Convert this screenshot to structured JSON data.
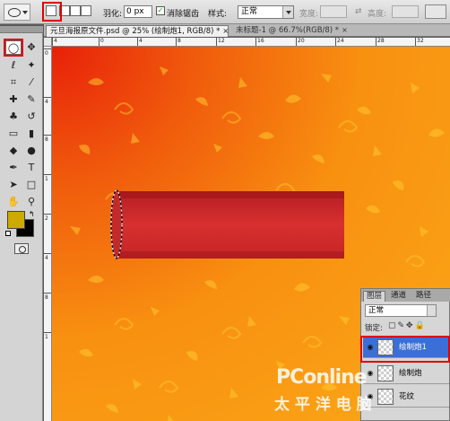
{
  "options_bar": {
    "feather_label": "羽化:",
    "feather_value": "0 px",
    "antialias_label": "消除锯齿",
    "style_label": "样式:",
    "style_value": "正常",
    "width_label": "宽度:",
    "height_label": "高度:"
  },
  "tabs": [
    {
      "label": "元旦海报原文件.psd @ 25% (绘制炮1, RGB/8) *"
    },
    {
      "label": "未标题-1 @ 66.7%(RGB/8) *"
    }
  ],
  "rulers": {
    "top": [
      "4",
      "0",
      "4",
      "8",
      "12",
      "16",
      "20",
      "24",
      "28",
      "32"
    ],
    "left": [
      "0",
      "4",
      "8",
      "1",
      "2",
      "4",
      "8",
      "1"
    ]
  },
  "layers_panel": {
    "tabs": [
      "图层",
      "通道",
      "路径"
    ],
    "blend_mode": "正常",
    "lock_label": "锁定:",
    "layers": [
      {
        "name": "绘制炮1",
        "selected": true
      },
      {
        "name": "绘制炮",
        "selected": false
      },
      {
        "name": "花纹",
        "selected": false
      }
    ]
  },
  "watermark": {
    "brand": "PConline",
    "chinese": "太 平 洋 电 脑"
  },
  "colors": {
    "foreground": "#ccaa00",
    "background": "#000000",
    "shape_fill": "#cc2a2a",
    "selection_highlight": "#e00000"
  }
}
